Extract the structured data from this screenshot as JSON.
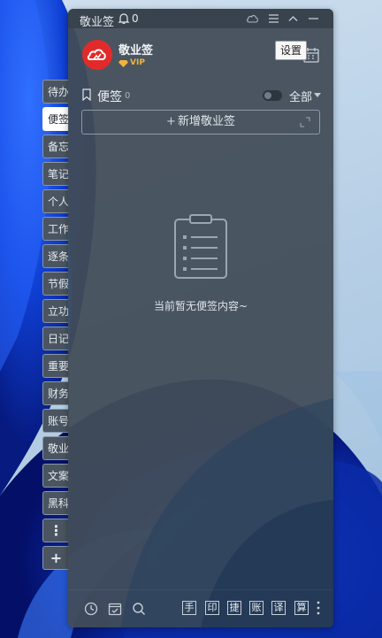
{
  "window": {
    "title": "敬业签",
    "notification_count": "0"
  },
  "profile": {
    "name": "敬业签",
    "badge": "VIP"
  },
  "tooltip": {
    "settings": "设置"
  },
  "notes": {
    "title": "便签",
    "count": "0",
    "filter_label": "全部",
    "add_button": "新增敬业签",
    "add_plus": "+",
    "empty_message": "当前暂无便签内容~"
  },
  "side_tabs": [
    {
      "label": "待办"
    },
    {
      "label": "便签"
    },
    {
      "label": "备忘"
    },
    {
      "label": "笔记"
    },
    {
      "label": "个人"
    },
    {
      "label": "工作"
    },
    {
      "label": "逐条"
    },
    {
      "label": "节假"
    },
    {
      "label": "立功"
    },
    {
      "label": "日记"
    },
    {
      "label": "重要"
    },
    {
      "label": "财务"
    },
    {
      "label": "账号"
    },
    {
      "label": "敬业"
    },
    {
      "label": "文案"
    },
    {
      "label": "黑科"
    },
    {
      "label": "⋮"
    },
    {
      "label": "+"
    }
  ],
  "toolbar": {
    "keys": [
      "手",
      "印",
      "捷",
      "账",
      "译",
      "算"
    ]
  },
  "icons": {
    "bell": "bell-icon",
    "cloud": "cloud-icon",
    "menu": "menu-icon",
    "collapse": "chevron-up-icon",
    "minimize": "minimize-icon",
    "calendar": "calendar-icon",
    "clock": "clock-icon",
    "task": "task-check-icon",
    "search": "search-icon",
    "more": "more-vertical-icon"
  },
  "colors": {
    "accent_red": "#e32a2a",
    "vip_gold": "#f1b43a",
    "panel": "#424d58"
  }
}
